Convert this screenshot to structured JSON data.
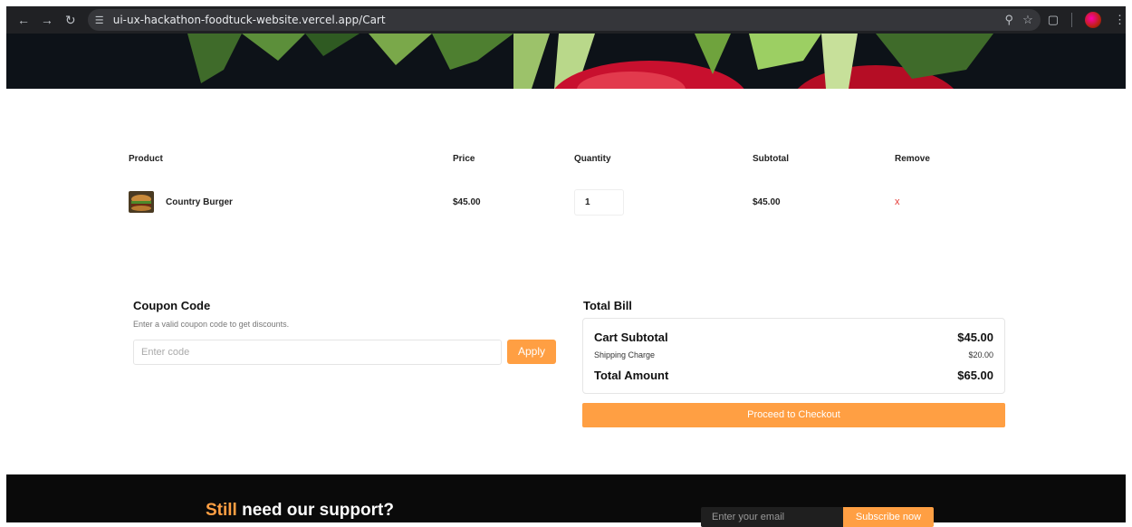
{
  "browser": {
    "url": "ui-ux-hackathon-foodtuck-website.vercel.app/Cart",
    "icons": [
      "back-icon",
      "forward-icon",
      "reload-icon",
      "site-settings-icon",
      "zoom-icon",
      "bookmark-star-icon",
      "extensions-icon",
      "profile-avatar",
      "menu-icon"
    ]
  },
  "cart": {
    "headers": {
      "product": "Product",
      "price": "Price",
      "quantity": "Quantity",
      "subtotal": "Subtotal",
      "remove": "Remove"
    },
    "items": [
      {
        "name": "Country Burger",
        "price": "$45.00",
        "quantity": "1",
        "subtotal": "$45.00",
        "remove": "x"
      }
    ]
  },
  "coupon": {
    "title": "Coupon Code",
    "subtitle": "Enter a valid coupon code to get discounts.",
    "placeholder": "Enter code",
    "apply_label": "Apply"
  },
  "bill": {
    "title": "Total Bill",
    "cart_subtotal_label": "Cart Subtotal",
    "cart_subtotal_value": "$45.00",
    "shipping_label": "Shipping Charge",
    "shipping_value": "$20.00",
    "total_label": "Total Amount",
    "total_value": "$65.00",
    "checkout_label": "Proceed to Checkout"
  },
  "footer": {
    "title_accent": "Still",
    "title_rest": " need our support?",
    "email_placeholder": "Enter your email",
    "subscribe_label": "Subscribe now"
  },
  "colors": {
    "accent": "#ff9f43",
    "remove": "#e53935",
    "footer_bg": "#0a0a0a"
  }
}
